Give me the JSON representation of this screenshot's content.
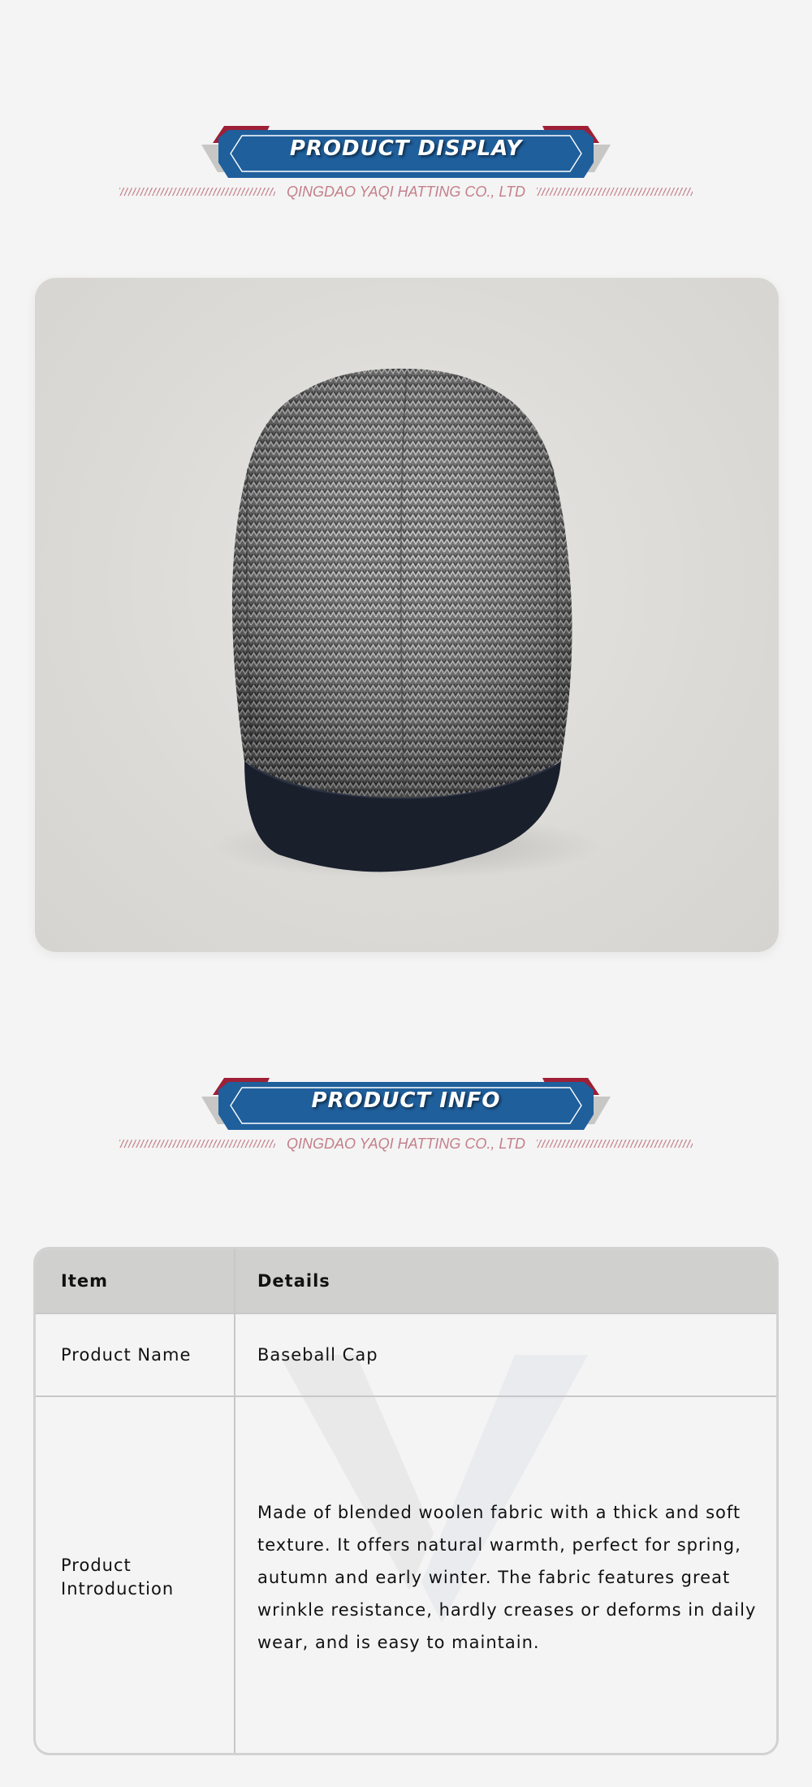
{
  "sections": {
    "display": {
      "title": "PRODUCT DISPLAY",
      "subtitle": "QINGDAO YAQI HATTING CO., LTD"
    },
    "info": {
      "title": "PRODUCT INFO",
      "subtitle": "QINGDAO YAQI HATTING CO., LTD"
    }
  },
  "product_image": {
    "subject": "grey herringbone flat cap with dark navy brim"
  },
  "table": {
    "headers": [
      "Item",
      "Details"
    ],
    "rows": [
      {
        "item": "Product Name",
        "details": "Baseball Cap"
      },
      {
        "item": "Product Introduction",
        "details": "Made of blended woolen fabric with a thick and soft texture. It offers natural warmth, perfect for spring, autumn and early winter. The fabric features great wrinkle resistance, hardly creases or deforms in daily wear, and is easy to maintain."
      }
    ]
  },
  "colors": {
    "banner_blue": "#1f5f9c",
    "banner_red": "#9e1f36",
    "banner_grey": "#c8c8c8",
    "subtitle_pink": "#c47f8a",
    "table_header_bg": "#d0d0cf",
    "page_bg": "#f4f4f4"
  }
}
